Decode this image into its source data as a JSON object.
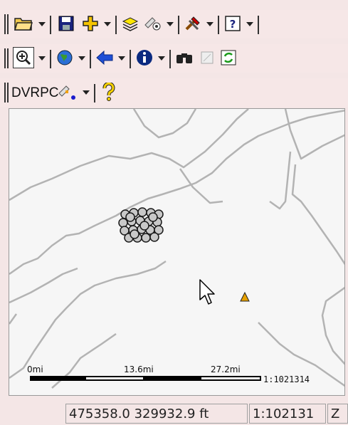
{
  "toolbars": {
    "row1": [
      "open-folder-icon",
      "save-disk-icon",
      "add-data-icon",
      "layers-icon",
      "identify-feature-icon",
      "tools-icon",
      "help-icon"
    ],
    "row2": [
      "zoom-in-icon",
      "globe-icon",
      "back-arrow-icon",
      "info-icon",
      "binoculars-icon",
      "disabled-tool-icon",
      "refresh-icon"
    ],
    "row3": {
      "label": "DVRPC",
      "icons": [
        "dvrpc-point-icon",
        "question-mark-icon"
      ]
    }
  },
  "map": {
    "scale_ticks": [
      "0mi",
      "13.6mi",
      "27.2mi"
    ],
    "scale_ratio": "1:1021314",
    "colors": {
      "boundary": "#b3b3b3",
      "points": "#c8c8c8",
      "triangle": "#e6a000"
    }
  },
  "statusbar": {
    "coordinates": "475358.0 329932.9 ft",
    "scale": "1:102131",
    "extra": "Z"
  }
}
